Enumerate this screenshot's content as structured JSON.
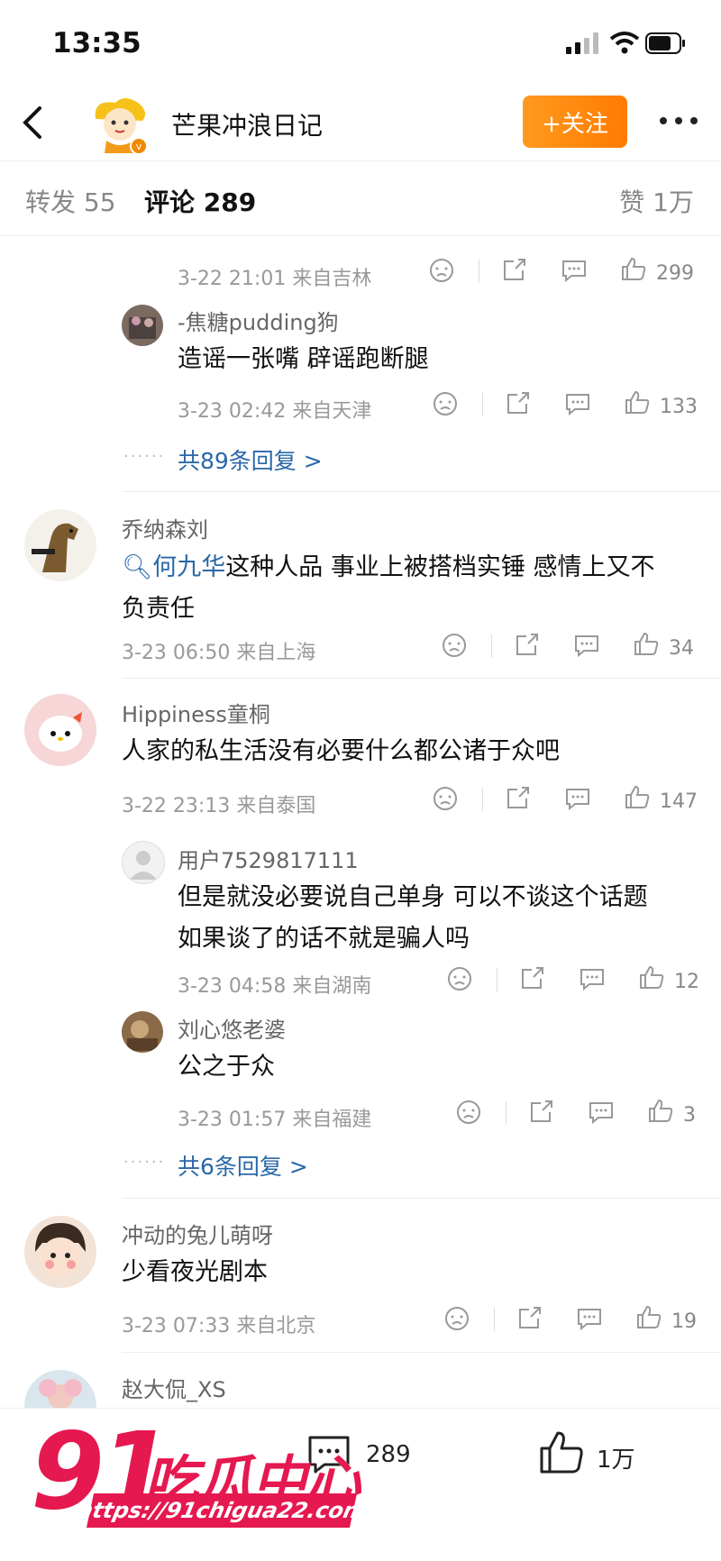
{
  "status_bar": {
    "time": "13:35"
  },
  "header": {
    "title": "芒果冲浪日记",
    "follow_label": "+关注"
  },
  "tabs": {
    "repost": "转发 55",
    "comments": "评论 289",
    "likes": "赞 1万"
  },
  "top_partial": {
    "meta": "3-22 21:01 来自吉林",
    "likes": "299"
  },
  "threads": [
    {
      "reply": {
        "name": "-焦糖pudding狗",
        "text": "造谣一张嘴 辟谣跑断腿",
        "meta": "3-23 02:42 来自天津",
        "likes": "133"
      },
      "more": "共89条回复 >"
    }
  ],
  "comments": [
    {
      "name": "乔纳森刘",
      "link": "何九华",
      "text_line1": "这种人品 事业上被搭档实锤 感情上又不",
      "text_line2": "负责任",
      "meta": "3-23 06:50 来自上海",
      "likes": "34"
    },
    {
      "name": "Hippiness童桐",
      "text": "人家的私生活没有必要什么都公诸于众吧",
      "meta": "3-22 23:13 来自泰国",
      "likes": "147",
      "replies": [
        {
          "name": "用户7529817111",
          "text_line1": "但是就没必要说自己单身 可以不谈这个话题",
          "text_line2": "如果谈了的话不就是骗人吗",
          "meta": "3-23 04:58 来自湖南",
          "likes": "12"
        },
        {
          "name": "刘心悠老婆",
          "text": "公之于众",
          "meta": "3-23 01:57 来自福建",
          "likes": "3"
        }
      ],
      "more": "共6条回复 >"
    },
    {
      "name": "冲动的兔儿萌呀",
      "text": "少看夜光剧本",
      "meta": "3-23 07:33 来自北京",
      "likes": "19"
    },
    {
      "name": "赵大侃_XS"
    }
  ],
  "bottom_bar": {
    "comments_count": "289",
    "likes_count": "1万"
  },
  "watermark": {
    "number": "91",
    "cn": "吃瓜中心",
    "url": "https://91chigua22.com"
  },
  "colors": {
    "accent": "#ff8a00",
    "link": "#2a68a8",
    "watermark": "#e5184f"
  }
}
